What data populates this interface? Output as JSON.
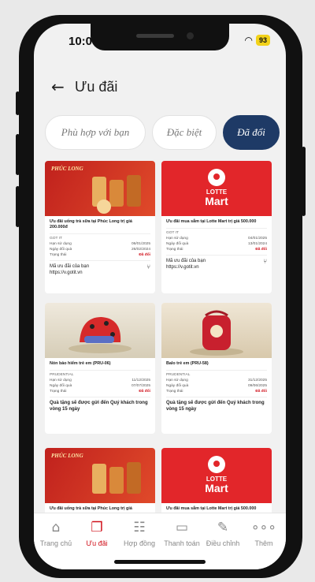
{
  "status": {
    "time": "10:0",
    "battery": "93"
  },
  "header": {
    "title": "Ưu đãi"
  },
  "tabs": [
    {
      "label": "Phù hợp với bạn"
    },
    {
      "label": "Đặc biệt"
    },
    {
      "label": "Đã đổi"
    }
  ],
  "cards": [
    {
      "title": "Ưu đãi uống trà sữa tại Phúc Long trị giá 200.000đ",
      "provider": "GOT IT",
      "rows": [
        [
          "Hạn sử dụng",
          "06/01/2025"
        ],
        [
          "Ngày đổi quà",
          "26/02/2024"
        ],
        [
          "Trạng thái",
          "Đã đổi"
        ]
      ],
      "code_label": "Mã ưu đãi của bạn",
      "code_value": "https://v.gotit.vn",
      "logo_text": "PHÚC LONG"
    },
    {
      "title": "Ưu đãi mua sắm tại Lotte Mart trị giá 500.000",
      "provider": "GOT IT",
      "rows": [
        [
          "Hạn sử dụng",
          "04/01/2025"
        ],
        [
          "Ngày đổi quà",
          "13/01/2024"
        ],
        [
          "Trạng thái",
          "Đã đổi"
        ]
      ],
      "code_label": "Mã ưu đãi của bạn",
      "code_value": "https://v.gotit.vn",
      "logo_t1": "LOTTE",
      "logo_t2": "Mart"
    },
    {
      "title": "Nón bảo hiểm trẻ em (PRU-06)",
      "provider": "PRUDENTIAL",
      "rows": [
        [
          "Hạn sử dụng",
          "11/12/2025"
        ],
        [
          "Ngày đổi quà",
          "07/07/2025"
        ],
        [
          "Trạng thái",
          "Đã đổi"
        ]
      ],
      "gift": "Quà tặng sẽ được gửi đến Quý khách trong vòng 15 ngày"
    },
    {
      "title": "Balo trẻ em (PRU-58)",
      "provider": "PRUDENTIAL",
      "rows": [
        [
          "Hạn sử dụng",
          "31/12/2025"
        ],
        [
          "Ngày đổi quà",
          "09/06/2025"
        ],
        [
          "Trạng thái",
          "Đã đổi"
        ]
      ],
      "gift": "Quà tặng sẽ được gửi đến Quý khách trong vòng 15 ngày"
    },
    {
      "title": "Ưu đãi uống trà sữa tại Phúc Long trị giá",
      "logo_text": "PHÚC LONG"
    },
    {
      "title": "Ưu đãi mua sắm tại Lotte Mart trị giá 500.000",
      "logo_t1": "LOTTE",
      "logo_t2": "Mart"
    }
  ],
  "nav": [
    {
      "label": "Trang chủ",
      "icon": "home-icon"
    },
    {
      "label": "Ưu đãi",
      "icon": "gift-icon"
    },
    {
      "label": "Hợp đồng",
      "icon": "contract-icon"
    },
    {
      "label": "Thanh toán",
      "icon": "payment-icon"
    },
    {
      "label": "Điều chỉnh",
      "icon": "edit-icon"
    },
    {
      "label": "Thêm",
      "icon": "more-icon"
    }
  ],
  "colors": {
    "accent": "#d0101a",
    "active_tab": "#1e3a66",
    "battery": "#f2d21a"
  }
}
